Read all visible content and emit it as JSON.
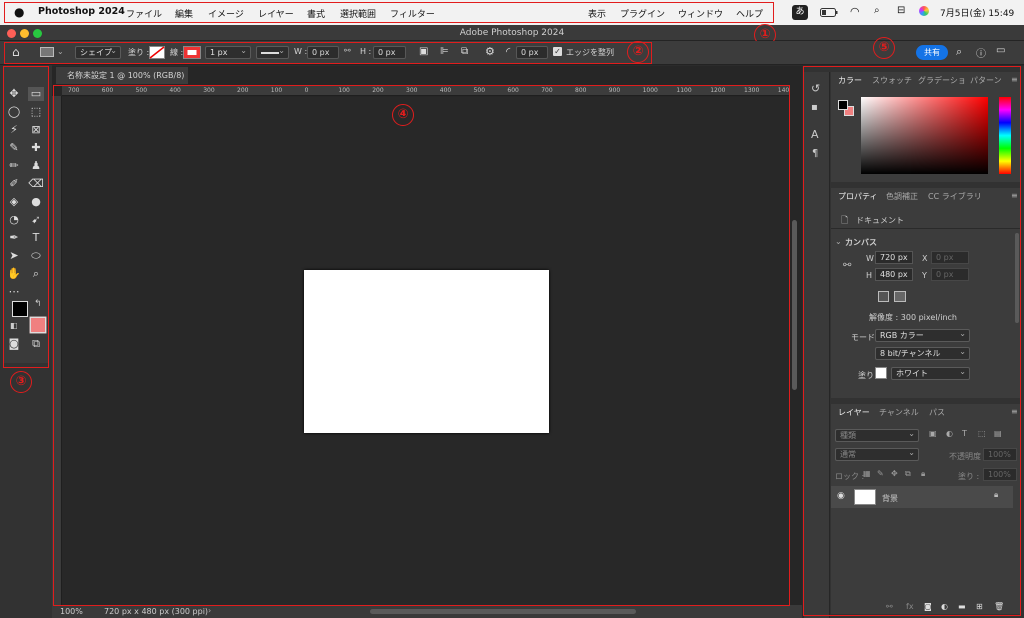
{
  "menubar": {
    "app_name": "Photoshop 2024",
    "items": [
      "ファイル",
      "編集",
      "イメージ",
      "レイヤー",
      "書式",
      "選択範囲",
      "フィルター",
      "表示",
      "プラグイン",
      "ウィンドウ",
      "ヘルプ"
    ],
    "input_mode": "あ",
    "date_time": "7月5日(金)  15:49"
  },
  "window": {
    "title": "Adobe Photoshop 2024"
  },
  "options": {
    "mode": "シェイプ",
    "fill_label": "塗り :",
    "stroke_label": "線 :",
    "stroke_width": "1 px",
    "w_label": "W :",
    "w_value": "0 px",
    "h_label": "H :",
    "h_value": "0 px",
    "radius_value": "0 px",
    "align_edges": "エッジを整列",
    "share": "共有"
  },
  "document": {
    "tab_title": "名称未設定 1 @ 100% (RGB/8)",
    "ruler_ticks": [
      "700",
      "600",
      "500",
      "400",
      "300",
      "200",
      "100",
      "0",
      "100",
      "200",
      "300",
      "400",
      "500",
      "600",
      "700",
      "800",
      "900",
      "1000",
      "1100",
      "1200",
      "1300",
      "1400"
    ],
    "zoom": "100%",
    "info": "720 px x 480 px (300 ppi)"
  },
  "annotations": [
    "①",
    "②",
    "③",
    "④",
    "⑤"
  ],
  "color_panel": {
    "tabs": [
      "カラー",
      "スウォッチ",
      "グラデーショ",
      "パターン"
    ]
  },
  "properties_panel": {
    "tabs": [
      "プロパティ",
      "色調補正",
      "CC ライブラリ"
    ],
    "doc_label": "ドキュメント",
    "section": "カンバス",
    "w_label": "W",
    "w_value": "720 px",
    "h_label": "H",
    "h_value": "480 px",
    "x_label": "X",
    "x_value": "0 px",
    "y_label": "Y",
    "y_value": "0 px",
    "resolution": "解像度 : 300 pixel/inch",
    "mode_label": "モード",
    "mode_value": "RGB カラー",
    "bit_value": "8 bit/チャンネル",
    "fill_label": "塗り",
    "fill_value": "ホワイト"
  },
  "layers_panel": {
    "tabs": [
      "レイヤー",
      "チャンネル",
      "パス"
    ],
    "filter_value": "種類",
    "blend_mode": "通常",
    "opacity_label": "不透明度 :",
    "opacity_value": "100%",
    "lock_label": "ロック :",
    "fill_label": "塗り :",
    "fill_value": "100%",
    "layer_name": "背景"
  },
  "colors": {
    "accent": "#1473e6",
    "annotation": "#e11d1d",
    "background_swatch": "#f08080"
  }
}
